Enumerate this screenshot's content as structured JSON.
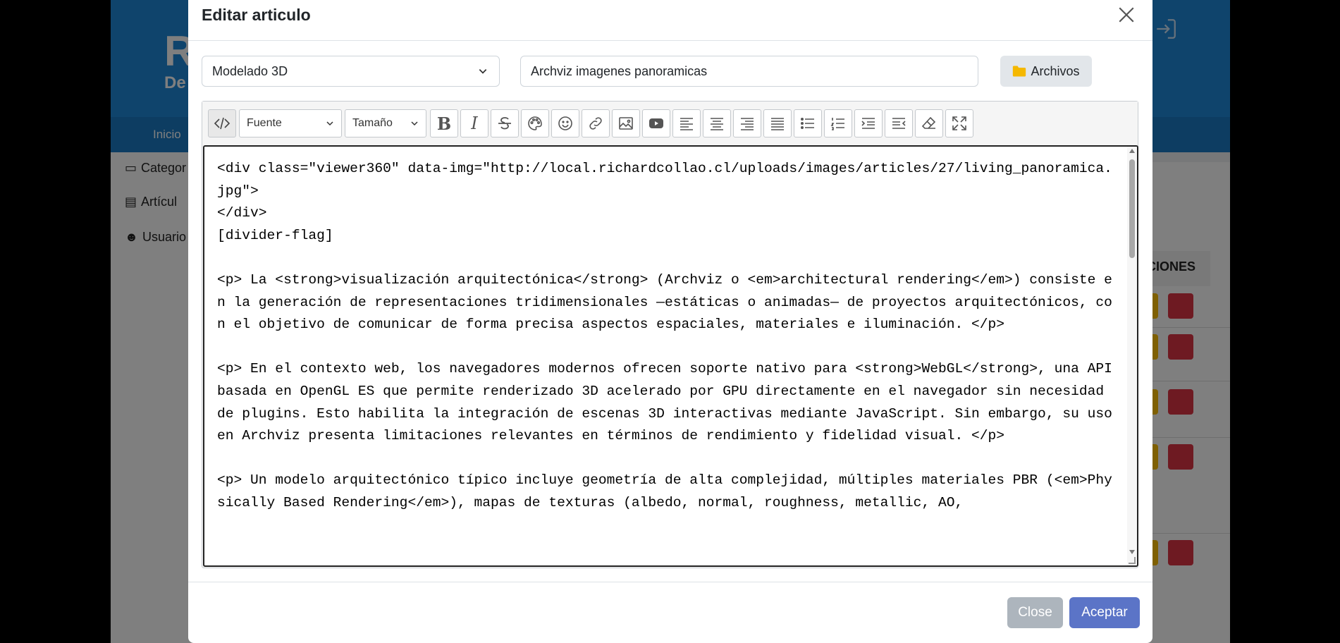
{
  "background": {
    "logo": "R",
    "logo_sub": "De",
    "nav_item": "Inicio",
    "sidebar": [
      "Categor",
      "Artícul",
      "Usuario"
    ],
    "table_header": "CIONES"
  },
  "modal": {
    "title": "Editar articulo",
    "category_select": "Modelado 3D",
    "title_input": "Archviz imagenes panoramicas",
    "files_button": "Archivos",
    "toolbar": {
      "font_dropdown": "Fuente",
      "size_dropdown": "Tamaño",
      "bold": "B",
      "italic": "I"
    },
    "code": "<div class=\"viewer360\" data-img=\"http://local.richardcollao.cl/uploads/images/articles/27/living_panoramica.jpg\">\n</div>\n[divider-flag]\n\n<p> La <strong>visualización arquitectónica</strong> (Archviz o <em>architectural rendering</em>) consiste en la generación de representaciones tridimensionales —estáticas o animadas— de proyectos arquitectónicos, con el objetivo de comunicar de forma precisa aspectos espaciales, materiales e iluminación. </p>\n\n<p> En el contexto web, los navegadores modernos ofrecen soporte nativo para <strong>WebGL</strong>, una API basada en OpenGL ES que permite renderizado 3D acelerado por GPU directamente en el navegador sin necesidad de plugins. Esto habilita la integración de escenas 3D interactivas mediante JavaScript. Sin embargo, su uso en Archviz presenta limitaciones relevantes en términos de rendimiento y fidelidad visual. </p>\n\n<p> Un modelo arquitectónico típico incluye geometría de alta complejidad, múltiples materiales PBR (<em>Physically Based Rendering</em>), mapas de texturas (albedo, normal, roughness, metallic, AO,",
    "close_button": "Close",
    "accept_button": "Aceptar"
  }
}
